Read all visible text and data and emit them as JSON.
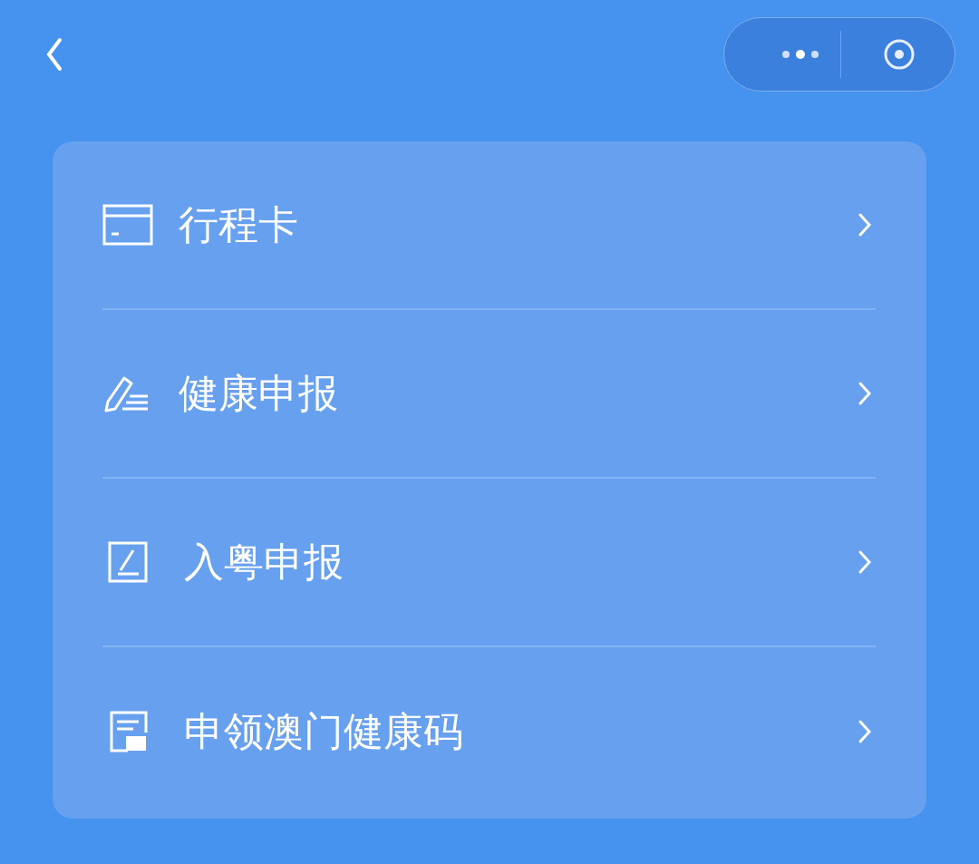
{
  "menu": [
    {
      "kind": "card",
      "label": "行程卡"
    },
    {
      "kind": "form",
      "label": "健康申报"
    },
    {
      "kind": "entry",
      "label": "入粤申报"
    },
    {
      "kind": "code",
      "label": "申领澳门健康码"
    }
  ]
}
